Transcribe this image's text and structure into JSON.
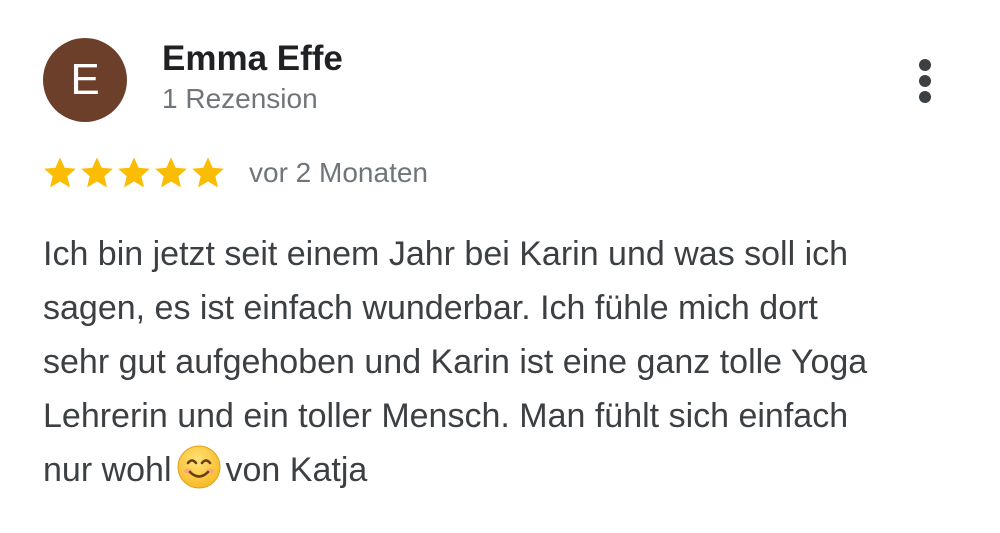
{
  "review": {
    "author": {
      "avatar_letter": "E",
      "avatar_color": "#6b3f2a",
      "name": "Emma Effe",
      "review_count": "1 Rezension"
    },
    "menu_icon": "more-vert-icon",
    "menu_color": "#3c4043",
    "rating": {
      "stars": 5,
      "max": 5,
      "color": "#fbbc04"
    },
    "timestamp": "vor 2 Monaten",
    "text_lines": [
      "Ich bin jetzt seit einem Jahr bei Karin und was soll ich",
      "sagen, es ist einfach wunderbar. Ich fühle mich dort",
      "sehr gut aufgehoben und Karin ist eine ganz tolle Yoga",
      "Lehrerin und ein toller Mensch. Man fühlt sich einfach"
    ],
    "last_line_before_emoji": "nur wohl",
    "emoji": "😊",
    "last_line_after_emoji": "von Katja"
  }
}
